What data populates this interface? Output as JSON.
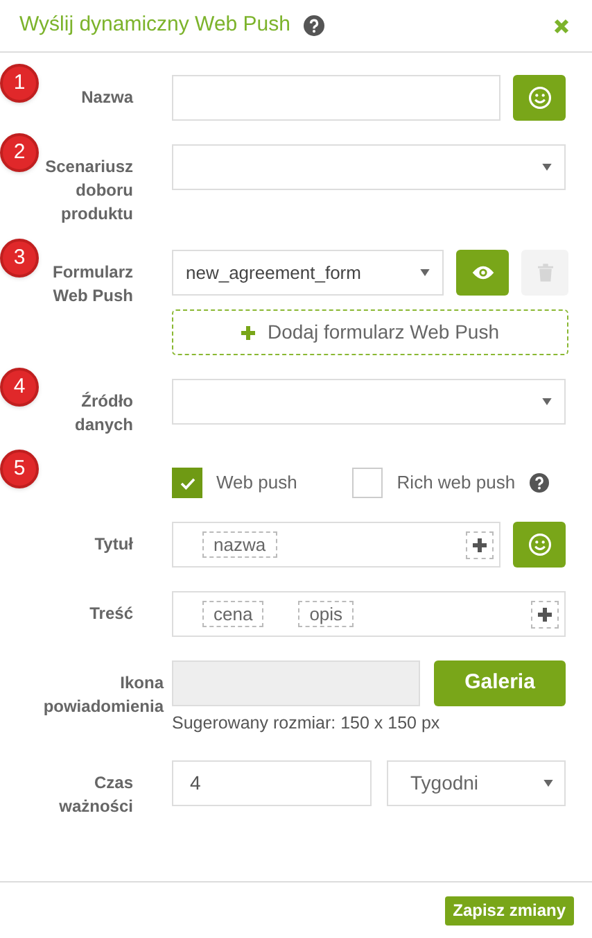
{
  "dialog": {
    "title": "Wyślij dynamiczny Web Push"
  },
  "form": [
    {
      "kind": "text_emoji",
      "marker": "1",
      "label": "Nazwa"
    },
    {
      "kind": "select",
      "marker": "2",
      "label": "Scenariusz doboru produktu"
    },
    {
      "kind": "select_actions",
      "marker": "3",
      "label": "Formularz Web Push",
      "value": "new_agreement_form",
      "add_label": "Dodaj formularz Web Push",
      "delete_disabled": true
    },
    {
      "kind": "select",
      "marker": "4",
      "label": "Źródło danych"
    },
    {
      "kind": "checkboxes",
      "marker": "5",
      "options": [
        {
          "label": "Web push",
          "checked": true
        },
        {
          "label": "Rich web push",
          "checked": false
        }
      ]
    },
    {
      "kind": "tags_emoji",
      "label": "Tytuł",
      "tags": [
        "nazwa"
      ]
    },
    {
      "kind": "tags",
      "label": "Treść",
      "tags": [
        "cena",
        "opis"
      ]
    },
    {
      "kind": "image",
      "label": "Ikona powiadomienia",
      "button": "Galeria",
      "hint": "Sugerowany rozmiar: 150 x 150 px"
    },
    {
      "kind": "duration",
      "label": "Czas ważności",
      "value": "4",
      "unit": "Tygodni"
    }
  ],
  "footer": {
    "save": "Zapisz zmiany"
  }
}
